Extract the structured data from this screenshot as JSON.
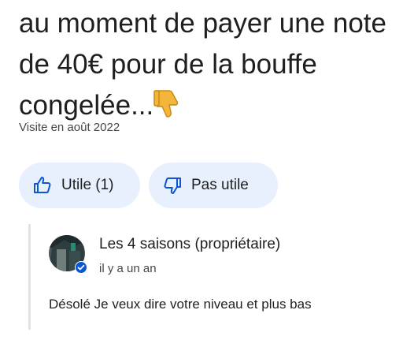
{
  "review": {
    "text": "au moment de payer une note de 40€ pour de la bouffe congelée...",
    "emoji_icon": "thumbs-down-emoji",
    "visit": "Visite en août 2022"
  },
  "actions": {
    "useful_label": "Utile (1)",
    "not_useful_label": "Pas utile",
    "useful_icon": "thumbs-up-outline-icon",
    "not_useful_icon": "thumbs-down-outline-icon"
  },
  "owner_reply": {
    "author": "Les 4 saisons (propriétaire)",
    "time": "il y a un an",
    "text": "Désolé Je veux dire votre niveau et plus bas",
    "verified_icon": "verified-badge-icon"
  },
  "colors": {
    "button_bg": "#e8f0fe",
    "icon_blue": "#0b57d0",
    "text_primary": "#1f1f1f",
    "text_secondary": "#444746",
    "thread_bar": "#e3e3e3",
    "emoji_yellow": "#f4b63a"
  }
}
